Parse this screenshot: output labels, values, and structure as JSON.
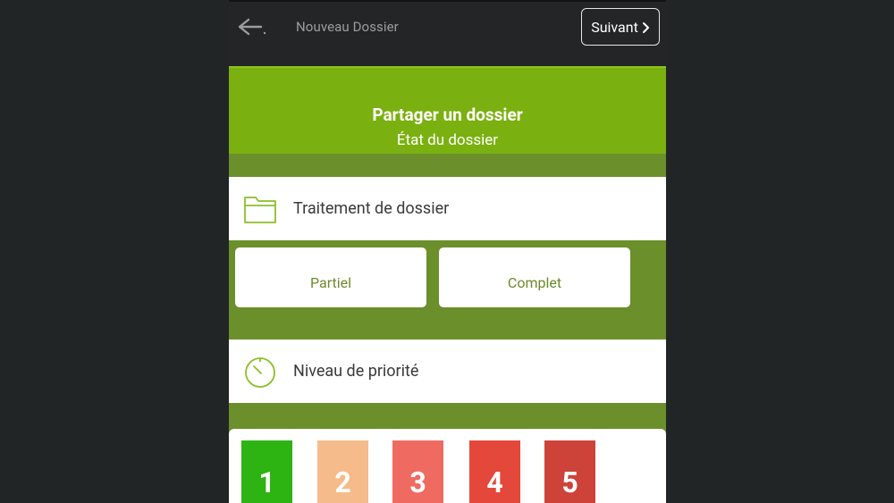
{
  "topbar": {
    "title": "Nouveau Dossier",
    "next_label": "Suivant",
    "back_icon": "arrow-left-icon",
    "next_icon": "chevron-right-icon"
  },
  "header": {
    "title": "Partager un dossier",
    "subtitle": "État du dossier"
  },
  "sections": {
    "treatment": {
      "label": "Traitement de dossier",
      "icon": "folder-icon"
    },
    "priority": {
      "label": "Niveau de priorité",
      "icon": "timer-icon"
    }
  },
  "treatment_options": [
    "Partiel",
    "Complet"
  ],
  "priority_levels": [
    {
      "label": "1",
      "color": "#2db312"
    },
    {
      "label": "2",
      "color": "#f6bb8a"
    },
    {
      "label": "3",
      "color": "#ef6b62"
    },
    {
      "label": "4",
      "color": "#e4483a"
    },
    {
      "label": "5",
      "color": "#cd433a"
    }
  ],
  "colors": {
    "accent_green": "#7bb011",
    "dark_green_bg": "#6b8f2b",
    "app_bg": "#232526"
  }
}
